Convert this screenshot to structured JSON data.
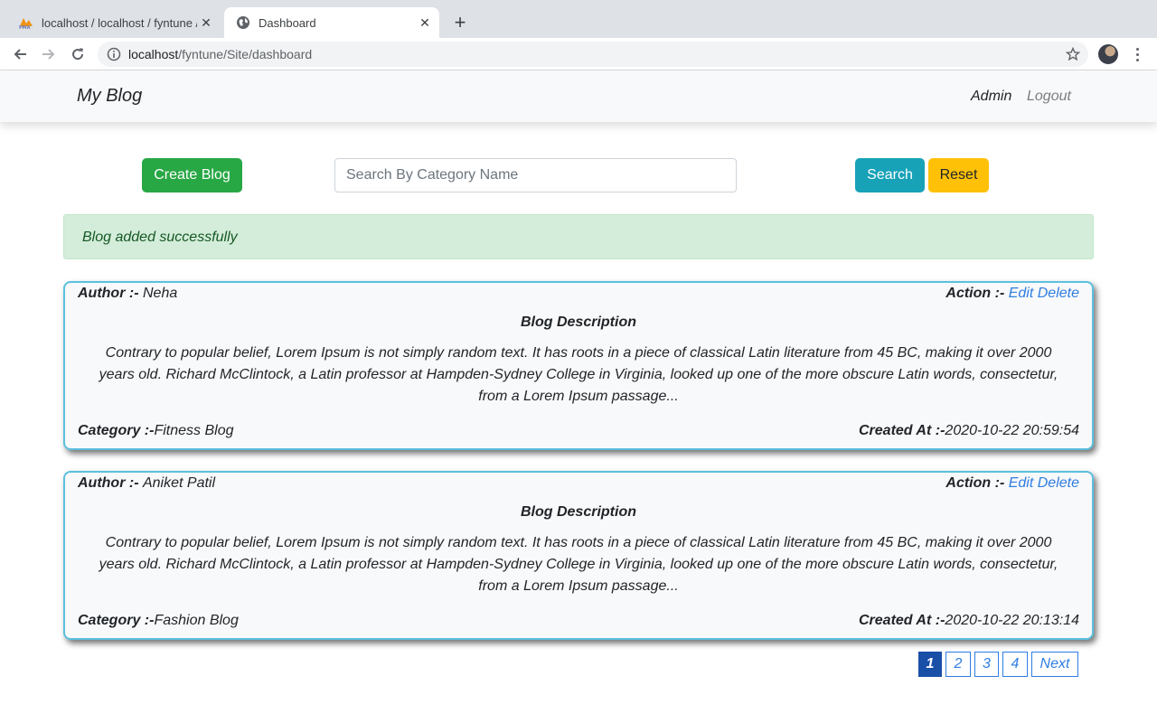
{
  "browser": {
    "tabs": [
      {
        "title": "localhost / localhost / fyntune / ",
        "active": false,
        "favicon": "phpmyadmin-icon"
      },
      {
        "title": "Dashboard",
        "active": true,
        "favicon": "globe-icon"
      }
    ],
    "url_host": "localhost",
    "url_path": "/fyntune/Site/dashboard"
  },
  "navbar": {
    "brand": "My Blog",
    "admin": "Admin",
    "logout": "Logout"
  },
  "controls": {
    "create_label": "Create Blog",
    "search_placeholder": "Search By Category Name",
    "search_value": "",
    "search_label": "Search",
    "reset_label": "Reset"
  },
  "alert": {
    "message": "Blog added successfully"
  },
  "labels": {
    "author": "Author :- ",
    "action": "Action :- ",
    "edit": "Edit",
    "delete": "Delete",
    "description_title": "Blog Description",
    "category": "Category :-",
    "created_at": "Created At :-"
  },
  "blogs": [
    {
      "author": "Neha",
      "description": "Contrary to popular belief, Lorem Ipsum is not simply random text. It has roots in a piece of classical Latin literature from 45 BC, making it over 2000 years old. Richard McClintock, a Latin professor at Hampden-Sydney College in Virginia, looked up one of the more obscure Latin words, consectetur, from a Lorem Ipsum passage...",
      "category": "Fitness Blog",
      "created_at": "2020-10-22 20:59:54"
    },
    {
      "author": "Aniket Patil",
      "description": "Contrary to popular belief, Lorem Ipsum is not simply random text. It has roots in a piece of classical Latin literature from 45 BC, making it over 2000 years old. Richard McClintock, a Latin professor at Hampden-Sydney College in Virginia, looked up one of the more obscure Latin words, consectetur, from a Lorem Ipsum passage...",
      "category": "Fashion Blog",
      "created_at": "2020-10-22 20:13:14"
    }
  ],
  "pagination": {
    "pages": [
      "1",
      "2",
      "3",
      "4"
    ],
    "current": "1",
    "next_label": "Next"
  },
  "colors": {
    "success": "#28a745",
    "info": "#17a2b8",
    "warning": "#ffc107",
    "link": "#2f7de1",
    "card_border": "#5bc0de"
  }
}
